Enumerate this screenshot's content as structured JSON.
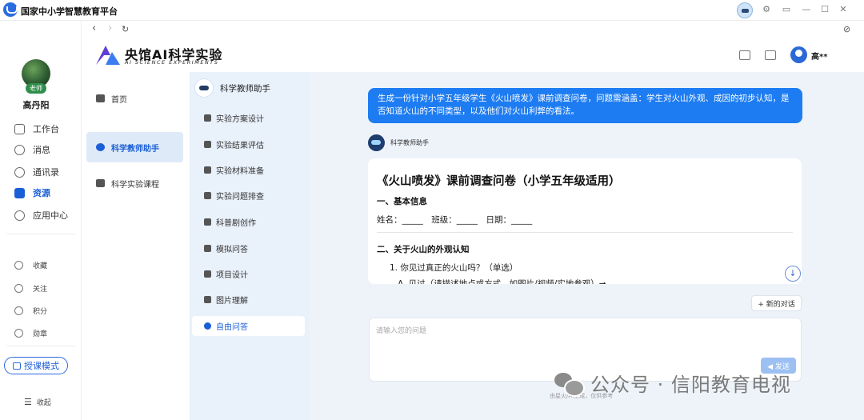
{
  "app": {
    "title": "国家中小学智慧教育平台"
  },
  "window_controls": {
    "settings": "⚙",
    "restore": "▭",
    "minimize": "—",
    "maximize": "☐",
    "close": "✕"
  },
  "left_nav": {
    "badge": "老师",
    "user_name": "高丹阳",
    "items": [
      {
        "label": "工作台"
      },
      {
        "label": "消息"
      },
      {
        "label": "通讯录"
      },
      {
        "label": "资源"
      },
      {
        "label": "应用中心"
      }
    ],
    "small_items": [
      {
        "label": "收藏"
      },
      {
        "label": "关注"
      },
      {
        "label": "积分"
      },
      {
        "label": "勋章"
      }
    ],
    "teach_mode": "授课模式",
    "collapse": "收起"
  },
  "browser": {
    "back": "‹",
    "forward": "›",
    "refresh": "↻",
    "extra": "⊘"
  },
  "header": {
    "brand_title": "央馆AI科学实验",
    "brand_subtitle": "AI SCIENCE EXPERIMENTS",
    "user_name": "高**"
  },
  "sidebar1": {
    "items": [
      {
        "label": "首页"
      },
      {
        "label": "科学教师助手"
      },
      {
        "label": "科学实验课程"
      }
    ]
  },
  "sidebar2": {
    "title": "科学教师助手",
    "items": [
      {
        "label": "实验方案设计"
      },
      {
        "label": "实验结果评估"
      },
      {
        "label": "实验材料准备"
      },
      {
        "label": "实验问题排查"
      },
      {
        "label": "科普剧创作"
      },
      {
        "label": "模拟问答"
      },
      {
        "label": "项目设计"
      },
      {
        "label": "图片理解"
      },
      {
        "label": "自由问答"
      }
    ]
  },
  "chat": {
    "user_message": "生成一份针对小学五年级学生《火山喷发》课前调查问卷，问题需涵盖：学生对火山外观、成因的初步认知，是否知道火山的不同类型，以及他们对火山利弊的看法。",
    "bot_name": "科学教师助手",
    "answer": {
      "title": "《火山喷发》课前调查问卷（小学五年级适用）",
      "section1": "一、基本信息",
      "basic_info": "姓名：_____　班级：_____　日期：_____",
      "section2": "二、关于火山的外观认知",
      "q1": "1. 你见过真正的火山吗？（单选）",
      "q1_a": "A. 见过（请描述地点或方式，如图片/视频/实地参观）→"
    },
    "scroll_down": "↓",
    "new_chat": "+ 新的对话",
    "input_placeholder": "请输入您的问题",
    "send": "◀ 发送",
    "disclaimer": "由星火/AI生成，仅供参考"
  },
  "watermark": {
    "text": "公众号 · 信阳教育电视"
  }
}
